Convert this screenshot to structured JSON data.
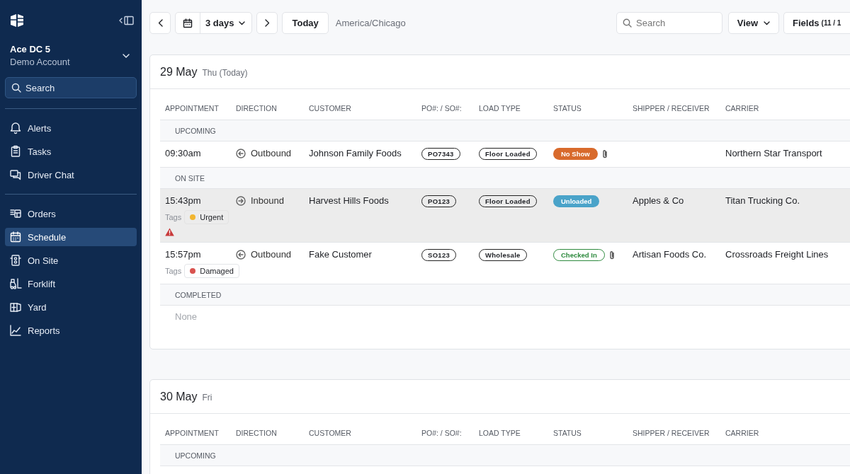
{
  "sidebar": {
    "account": {
      "name": "Ace DC 5",
      "subtitle": "Demo Account"
    },
    "search": {
      "placeholder": "Search"
    },
    "sections": [
      {
        "items": [
          {
            "label": "Alerts",
            "selected": false
          },
          {
            "label": "Tasks",
            "selected": false
          },
          {
            "label": "Driver Chat",
            "selected": false
          }
        ]
      },
      {
        "items": [
          {
            "label": "Orders",
            "selected": false
          },
          {
            "label": "Schedule",
            "selected": true
          },
          {
            "label": "On Site",
            "selected": false
          },
          {
            "label": "Forklift",
            "selected": false
          },
          {
            "label": "Yard",
            "selected": false
          },
          {
            "label": "Reports",
            "selected": false
          }
        ]
      }
    ]
  },
  "toolbar": {
    "range": "3 days",
    "today": "Today",
    "timezone": "America/Chicago",
    "search": {
      "placeholder": "Search"
    },
    "view": "View",
    "fields": {
      "label": "Fields",
      "count": "(11 / 1"
    }
  },
  "days": [
    {
      "date": "29 May",
      "weekday": "Thu (Today)",
      "columns": [
        "APPOINTMENT",
        "DIRECTION",
        "CUSTOMER",
        "PO#: / SO#:",
        "LOAD TYPE",
        "STATUS",
        "SHIPPER / RECEIVER",
        "CARRIER"
      ],
      "groups": [
        {
          "label": "UPCOMING",
          "rows": [
            {
              "time": "09:30am",
              "direction": {
                "label": "Outbound",
                "kind": "outbound"
              },
              "customer": "Johnson Family Foods",
              "order": "PO7343",
              "load_type": "Floor Loaded",
              "status": {
                "label": "No Show",
                "kind": "no_show"
              },
              "attachment": true,
              "shipper": "",
              "carrier": "Northern Star Transport",
              "selected": false,
              "alert": false
            }
          ]
        },
        {
          "label": "ON SITE",
          "rows": [
            {
              "time": "15:43pm",
              "direction": {
                "label": "Inbound",
                "kind": "inbound"
              },
              "customer": "Harvest Hills Foods",
              "order": "PO123",
              "load_type": "Floor Loaded",
              "status": {
                "label": "Unloaded",
                "kind": "unloaded"
              },
              "attachment": false,
              "shipper": "Apples & Co",
              "carrier": "Titan Trucking Co.",
              "selected": true,
              "alert": true,
              "tags_label": "Tags",
              "tags": [
                {
                  "label": "Urgent",
                  "color": "#f2b630"
                }
              ]
            },
            {
              "time": "15:57pm",
              "direction": {
                "label": "Outbound",
                "kind": "outbound"
              },
              "customer": "Fake Customer",
              "order": "SO123",
              "load_type": "Wholesale",
              "status": {
                "label": "Checked In",
                "kind": "checked_in"
              },
              "attachment": true,
              "shipper": "Artisan Foods Co.",
              "carrier": "Crossroads Freight Lines",
              "selected": false,
              "alert": false,
              "tags_label": "Tags",
              "tags": [
                {
                  "label": "Damaged",
                  "color": "#d9534f"
                }
              ]
            }
          ]
        },
        {
          "label": "COMPLETED",
          "empty": "None"
        }
      ]
    },
    {
      "date": "30 May",
      "weekday": "Fri",
      "columns": [
        "APPOINTMENT",
        "DIRECTION",
        "CUSTOMER",
        "PO#: / SO#:",
        "LOAD TYPE",
        "STATUS",
        "SHIPPER / RECEIVER",
        "CARRIER"
      ],
      "groups": [
        {
          "label": "UPCOMING"
        }
      ]
    }
  ]
}
